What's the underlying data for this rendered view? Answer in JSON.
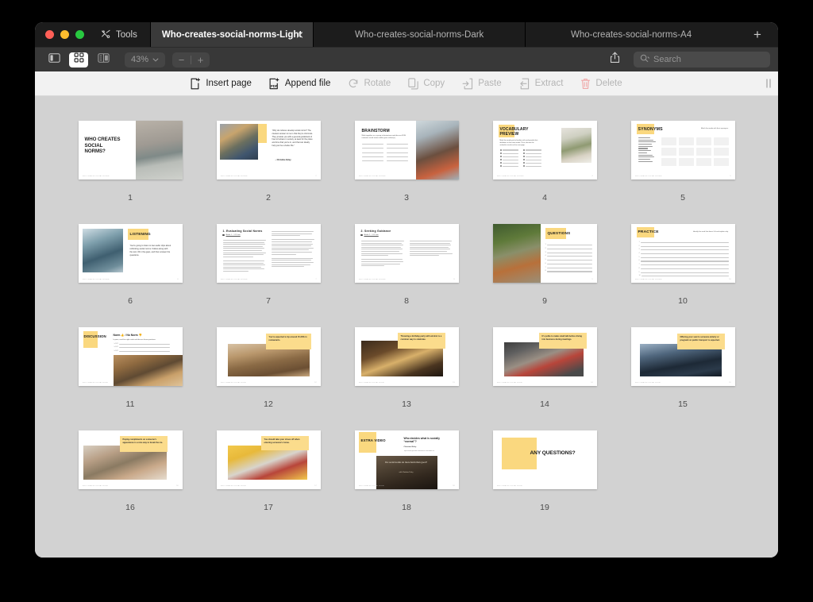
{
  "window": {
    "traffic_lights": [
      "close",
      "minimize",
      "maximize"
    ],
    "tools_label": "Tools"
  },
  "tabs": [
    {
      "label": "Who-creates-social-norms-Light",
      "active": true,
      "closable": true
    },
    {
      "label": "Who-creates-social-norms-Dark",
      "active": false,
      "closable": false
    },
    {
      "label": "Who-creates-social-norms-A4",
      "active": false,
      "closable": false
    }
  ],
  "new_tab_label": "+",
  "toolbar": {
    "view_buttons": [
      {
        "name": "sidebar-view",
        "active": false
      },
      {
        "name": "grid-view",
        "active": true
      },
      {
        "name": "split-view",
        "active": false
      }
    ],
    "zoom_value": "43%",
    "zoom_out_label": "−",
    "zoom_in_label": "+",
    "share_icon": "share-icon",
    "search_placeholder": "Search"
  },
  "action_bar": {
    "actions": [
      {
        "label": "Insert page",
        "icon": "insert-page-icon",
        "enabled": true
      },
      {
        "label": "Append file",
        "icon": "append-file-icon",
        "enabled": true
      },
      {
        "label": "Rotate",
        "icon": "rotate-icon",
        "enabled": false
      },
      {
        "label": "Copy",
        "icon": "copy-icon",
        "enabled": false
      },
      {
        "label": "Paste",
        "icon": "paste-icon",
        "enabled": false
      },
      {
        "label": "Extract",
        "icon": "extract-icon",
        "enabled": false
      },
      {
        "label": "Delete",
        "icon": "trash-icon",
        "enabled": false
      }
    ]
  },
  "document": {
    "footer_text": "WHO CREATES SOCIAL NORMS?",
    "accent_color": "#fad87f",
    "page_count": 19,
    "pages": [
      {
        "number": "1",
        "layout": "title-photo",
        "title": "WHO CREATES SOCIAL NORMS?",
        "photo": "ph-lake"
      },
      {
        "number": "2",
        "layout": "quote-photo",
        "quote": "“Why do cultures develop social norms? The clearest answer to me is that they're shortcuts. They provide you with a general guidebook of how to behave in society, at least for the place and time that you're in, and that can ideally help you live a better life.”",
        "attribution": "– Christine Exley",
        "photo": "ph-crowd"
      },
      {
        "number": "3",
        "layout": "brainstorm",
        "title": "BRAINSTORM",
        "subtitle": "Work together as a group to brainstorm and discuss FIVE common social norms within your culture(s).",
        "photo": "ph-office"
      },
      {
        "number": "4",
        "layout": "vocabulary",
        "title": "VOCABULARY PREVIEW",
        "subtitle": "Mark the words you're familiar with and provide their definition in their own words. Then, discuss the unfamiliar vocab on the next page.",
        "photo": "ph-plant"
      },
      {
        "number": "5",
        "layout": "synonyms",
        "title": "SYNONYMS",
        "subtitle": "Match the words with their synonyms.",
        "word_list": [
          "Adhere",
          "Look upon",
          "Reinforcement",
          "Conceptual",
          "Keep in line",
          "Norms",
          "Guidance",
          "Stand",
          "Gratifying",
          "Adherence",
          "Consider",
          "Applicable"
        ],
        "cards": [
          "Conform to",
          "Regard as",
          "Approval",
          "Theoretical",
          "Stay on track",
          "Standards",
          "Direction",
          "Position",
          "Satisfying",
          "Compliance",
          "Think about",
          "Relevant"
        ]
      },
      {
        "number": "6",
        "layout": "listening",
        "title": "LISTENING",
        "body": "You're going to listen to two audio clips about rethinking social norms. Follow along with the text, fill in the gaps, and then answer the questions.",
        "photo": "ph-bus"
      },
      {
        "number": "7",
        "layout": "text-two-col",
        "title": "1. Evaluating Social Norms",
        "audio_label": "Audio 1 – 1:19 min"
      },
      {
        "number": "8",
        "layout": "text-two-col",
        "title": "2. Seeking Guidance",
        "audio_label": "Audio 2 – 1:07 min"
      },
      {
        "number": "9",
        "layout": "questions",
        "title": "QUESTIONS",
        "photo": "ph-garden",
        "items": [
          "What are social norms, according to the text?",
          "How do norms act like shortcuts?",
          "Why is it important to reconsider or rethink social norms?",
          "What are different social norms in different societies?",
          "What do people seek in a ‘Clarification’ or an opinion about someone's conduct?",
          "Why is it hard to speak up or protest when traditional rules are no longer beneficial?",
          "How do people question social norms?",
          "What is driving the profound debate we see on established cultural practices in our individualistic world?"
        ]
      },
      {
        "number": "10",
        "layout": "practice",
        "title": "PRACTICE",
        "subtitle": "Identify the word that doesn't fit and explain why.",
        "count": 10
      },
      {
        "number": "11",
        "layout": "discussion",
        "title": "DISCUSSION",
        "heading": "Norm 👍 / No Norm 👎",
        "instructions": "In pairs, read the eight cards and discuss these questions:",
        "bullets": [
          "Are any of the norms or not adapted to the point it is still a cultural norm?",
          "Where are the benefits or drawbacks of these my/the norm?",
          "Would people not like this?"
        ],
        "photo": "ph-drinks"
      },
      {
        "number": "12",
        "layout": "norm-card",
        "card_text": "You're expected to tip around 15-20% in restaurants.",
        "photo": "ph-wood"
      },
      {
        "number": "13",
        "layout": "norm-card",
        "card_text": "Throwing a birthday party with alcohol is a common way to celebrate.",
        "photo": "ph-toast"
      },
      {
        "number": "14",
        "layout": "norm-card",
        "card_text": "It's polite to make small talk before diving into business during meetings.",
        "photo": "ph-meet"
      },
      {
        "number": "15",
        "layout": "norm-card",
        "card_text": "Offering your seat to someone elderly or pregnant on public transport is expected.",
        "photo": "ph-train"
      },
      {
        "number": "16",
        "layout": "norm-card",
        "card_text": "Paying compliments on someone's appearance is a nice way to break the ice.",
        "photo": "ph-cafe"
      },
      {
        "number": "17",
        "layout": "norm-card",
        "card_text": "You should take your shoes off when entering someone's home.",
        "photo": "ph-socks"
      },
      {
        "number": "18",
        "layout": "extra-video",
        "title": "EXTRA VIDEO",
        "video_title": "Who decides what is socially “normal”?",
        "speaker": "Christine Exley",
        "link_text": "https://www.youtube.com/watch?v=EXAMPLE",
        "thumb_title": "Do social norms do more harm than good?",
        "thumb_sub": "with Christine Exley",
        "photo": "ph-video"
      },
      {
        "number": "19",
        "layout": "any-questions",
        "title": "ANY QUESTIONS?"
      }
    ]
  }
}
